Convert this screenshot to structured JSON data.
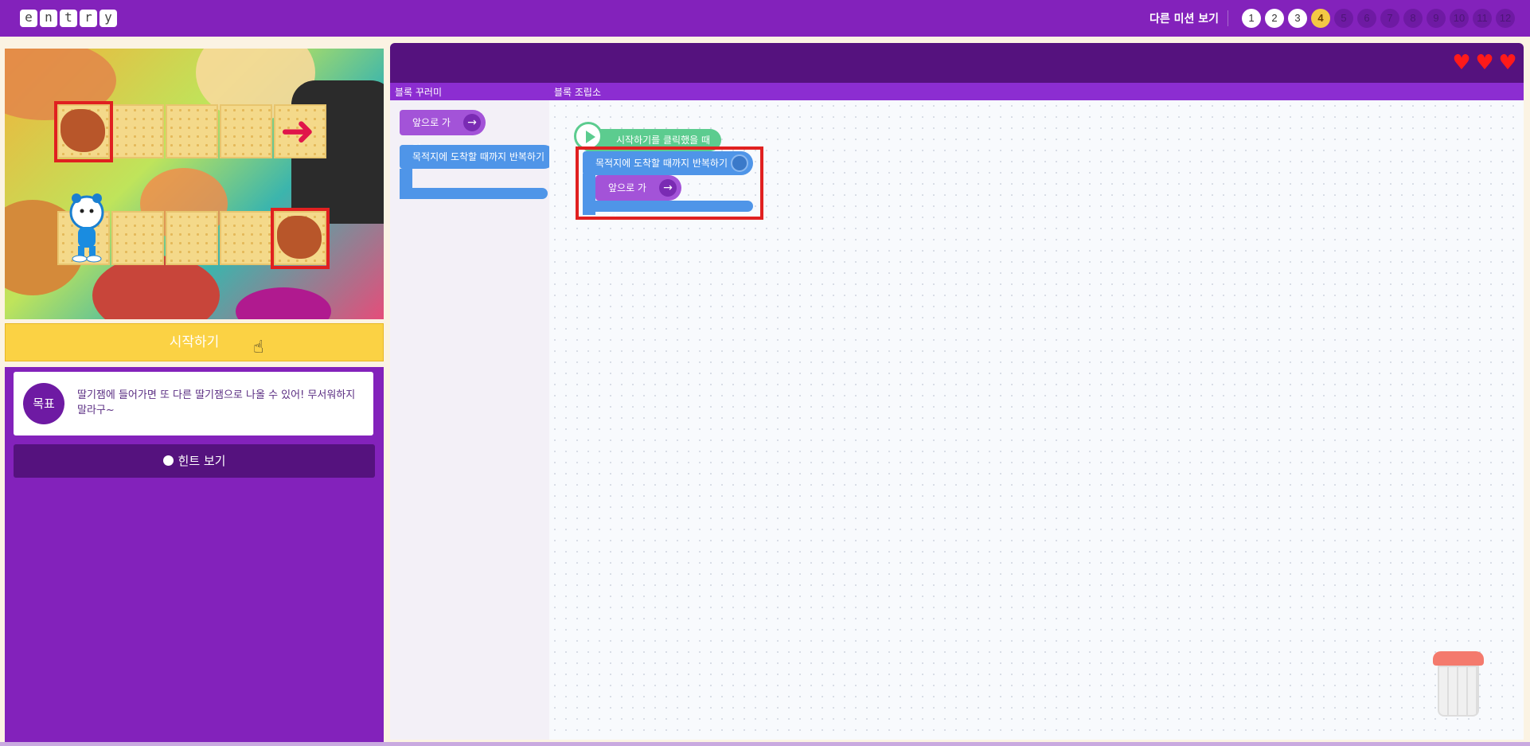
{
  "header": {
    "logo_letters": [
      "e",
      "n",
      "t",
      "r",
      "y"
    ],
    "other_missions_label": "다른 미션 보기",
    "levels": [
      {
        "label": "1",
        "state": "done"
      },
      {
        "label": "2",
        "state": "done"
      },
      {
        "label": "3",
        "state": "done"
      },
      {
        "label": "4",
        "state": "current"
      },
      {
        "label": "5",
        "state": "locked"
      },
      {
        "label": "6",
        "state": "locked"
      },
      {
        "label": "7",
        "state": "locked"
      },
      {
        "label": "8",
        "state": "locked"
      },
      {
        "label": "9",
        "state": "locked"
      },
      {
        "label": "10",
        "state": "locked"
      },
      {
        "label": "11",
        "state": "locked"
      },
      {
        "label": "12",
        "state": "locked"
      }
    ]
  },
  "stage": {
    "start_button": "시작하기"
  },
  "goal": {
    "badge": "목표",
    "text": "딸기잼에 들어가면 또 다른 딸기잼으로 나올 수 있어! 무서워하지 말라구~"
  },
  "hint": {
    "label": "힌트 보기",
    "icon": "lightbulb-icon"
  },
  "workspace": {
    "lives": 3,
    "palette_label": "블록 꾸러미",
    "assembly_label": "블록 조립소"
  },
  "palette_blocks": {
    "move_forward": "앞으로 가기",
    "repeat_until": "목적지에 도착할 때까지 반복하기"
  },
  "assembly_blocks": {
    "when_start": "시작하기를 클릭했을 때",
    "repeat_until": "목적지에 도착할 때까지 반복하기",
    "move_forward": "앞으로 가기"
  },
  "colors": {
    "brand_purple": "#8322bb",
    "dark_purple": "#55127e",
    "start_yellow": "#fbd244",
    "move_block": "#a353d8",
    "repeat_block": "#4f95e8",
    "start_block": "#5ccc8f",
    "highlight_red": "#e02020"
  }
}
